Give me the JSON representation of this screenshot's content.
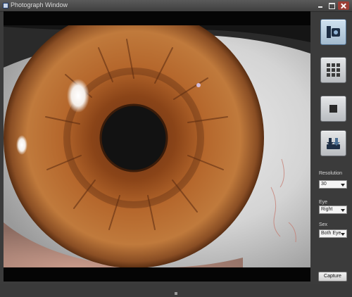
{
  "window": {
    "title": "Photograph Window"
  },
  "toolbar": {
    "buttons": [
      {
        "name": "capture",
        "icon": "camera-icon",
        "state": "active"
      },
      {
        "name": "grid",
        "icon": "grid-icon"
      },
      {
        "name": "stop",
        "icon": "stop-icon"
      },
      {
        "name": "transfer",
        "icon": "transfer-icon"
      }
    ]
  },
  "controls": {
    "resolution": {
      "label": "Resolution",
      "value": "30"
    },
    "eye": {
      "label": "Eye",
      "value": "Right"
    },
    "sex": {
      "label": "Sex",
      "value": "Both Eye"
    }
  },
  "actions": {
    "primary_label": "Capture"
  },
  "colors": {
    "iris": "#b5672c",
    "pupil": "#121212",
    "sclera": "#dedede",
    "chrome": "#3b3b3b"
  }
}
